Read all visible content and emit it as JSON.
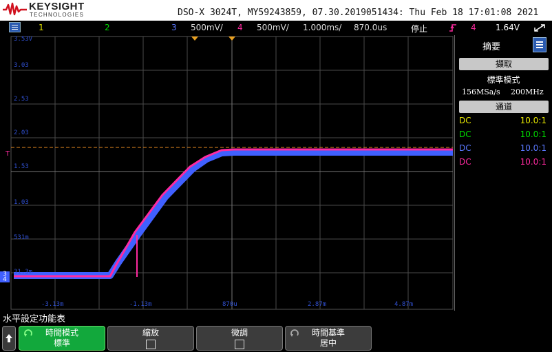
{
  "header": {
    "brand": "KEYSIGHT",
    "brand_sub": "TECHNOLOGIES",
    "model_info": "DSO-X 3024T, MY59243859, 07.30.2019051434: Thu Feb 18 17:01:08 2021"
  },
  "status": {
    "ch1": "1",
    "ch2": "2",
    "ch3": "3",
    "ch3_scale": "500mV/",
    "ch4": "4",
    "ch4_scale": "500mV/",
    "timebase": "1.000ms/",
    "delay": "870.0us",
    "run_state": "停止",
    "trig_source": "4",
    "trig_level": "1.64V"
  },
  "screen": {
    "y_labels": [
      "3.53V",
      "3.03",
      "2.53",
      "2.03",
      "1.53",
      "1.03",
      "531m",
      "31.3m"
    ],
    "x_labels": [
      "-3.13m",
      "-1.13m",
      "870u",
      "2.87m",
      "4.87m"
    ],
    "trigger_marker": "T",
    "ch3_marker": "3",
    "ch4_marker": "4"
  },
  "side": {
    "title": "摘要",
    "acquire_btn": "擷取",
    "acq_mode": "標準模式",
    "sample_rate": "156MSa/s",
    "bandwidth": "200MHz",
    "channels_btn": "通道",
    "channels": [
      {
        "coupling": "DC",
        "ratio": "10.0:1",
        "color": "#e8e800"
      },
      {
        "coupling": "DC",
        "ratio": "10.0:1",
        "color": "#00dd00"
      },
      {
        "coupling": "DC",
        "ratio": "10.0:1",
        "color": "#5a78ff"
      },
      {
        "coupling": "DC",
        "ratio": "10.0:1",
        "color": "#ff2aa0"
      }
    ]
  },
  "softkeys": {
    "menu_title": "水平設定功能表",
    "time_mode_label": "時間模式",
    "time_mode_value": "標準",
    "zoom_label": "縮放",
    "fine_label": "微調",
    "time_ref_label": "時間基準",
    "time_ref_value": "居中"
  }
}
